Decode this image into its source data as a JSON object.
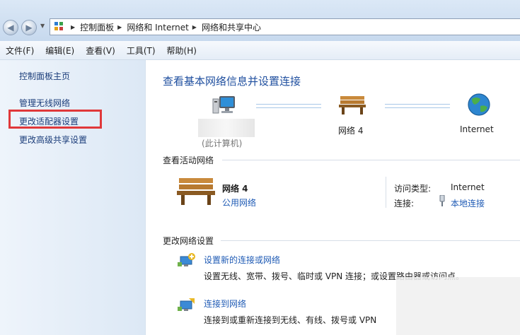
{
  "address_bar": {
    "breadcrumbs": [
      "控制面板",
      "网络和 Internet",
      "网络和共享中心"
    ],
    "icons": [
      "back-icon",
      "forward-icon",
      "control-panel-icon"
    ]
  },
  "menu": [
    "文件(F)",
    "编辑(E)",
    "查看(V)",
    "工具(T)",
    "帮助(H)"
  ],
  "sidebar": {
    "items": [
      {
        "label": "控制面板主页"
      },
      {
        "label": "管理无线网络"
      },
      {
        "label": "更改适配器设置",
        "highlighted": true
      },
      {
        "label": "更改高级共享设置"
      }
    ],
    "highlight_color": "#e0383a"
  },
  "main": {
    "title": "查看基本网络信息并设置连接",
    "map": {
      "computer_label": "(此计算机)",
      "network_label": "网络  4",
      "internet_label": "Internet"
    },
    "active": {
      "section_title": "查看活动网络",
      "network_name": "网络  4",
      "network_type": "公用网络",
      "access_type_label": "访问类型:",
      "access_type_value": "Internet",
      "connections_label": "连接:",
      "connections_value": "本地连接"
    },
    "change": {
      "section_title": "更改网络设置",
      "items": [
        {
          "link": "设置新的连接或网络",
          "desc": "设置无线、宽带、拨号、临时或 VPN 连接；或设置路由器或访问点。"
        },
        {
          "link": "连接到网络",
          "desc": "连接到或重新连接到无线、有线、拨号或 VPN"
        }
      ]
    }
  },
  "colors": {
    "link": "#1f5bb5",
    "title": "#1f4f9f",
    "sidebar_bg": "#e4edf7"
  }
}
